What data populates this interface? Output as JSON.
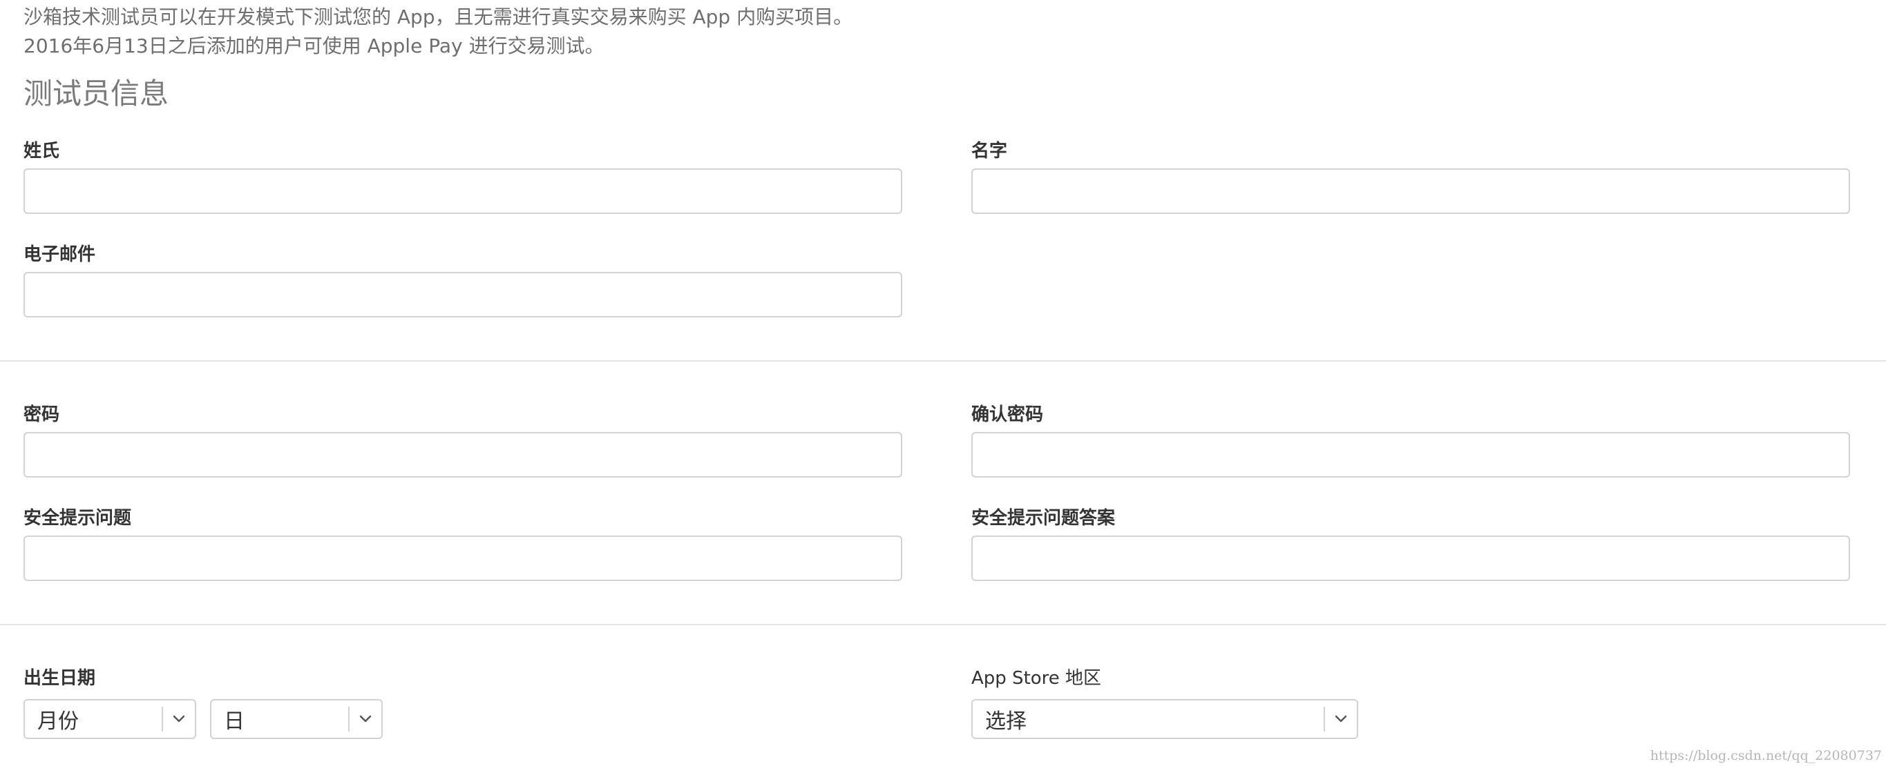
{
  "intro": {
    "line1": "沙箱技术测试员可以在开发模式下测试您的 App，且无需进行真实交易来购买 App 内购买项目。",
    "line2": "2016年6月13日之后添加的用户可使用 Apple Pay 进行交易测试。"
  },
  "section_title": "测试员信息",
  "fields": {
    "last_name": {
      "label": "姓氏",
      "value": ""
    },
    "first_name": {
      "label": "名字",
      "value": ""
    },
    "email": {
      "label": "电子邮件",
      "value": ""
    },
    "password": {
      "label": "密码",
      "value": ""
    },
    "confirm_password": {
      "label": "确认密码",
      "value": ""
    },
    "security_question": {
      "label": "安全提示问题",
      "value": ""
    },
    "security_answer": {
      "label": "安全提示问题答案",
      "value": ""
    }
  },
  "birthdate": {
    "label": "出生日期",
    "month_selected": "月份",
    "day_selected": "日"
  },
  "store_region": {
    "label": "App Store 地区",
    "selected": "选择"
  },
  "icons": {
    "dropdown": "chevron-down-icon"
  },
  "watermark": "https://blog.csdn.net/qq_22080737"
}
